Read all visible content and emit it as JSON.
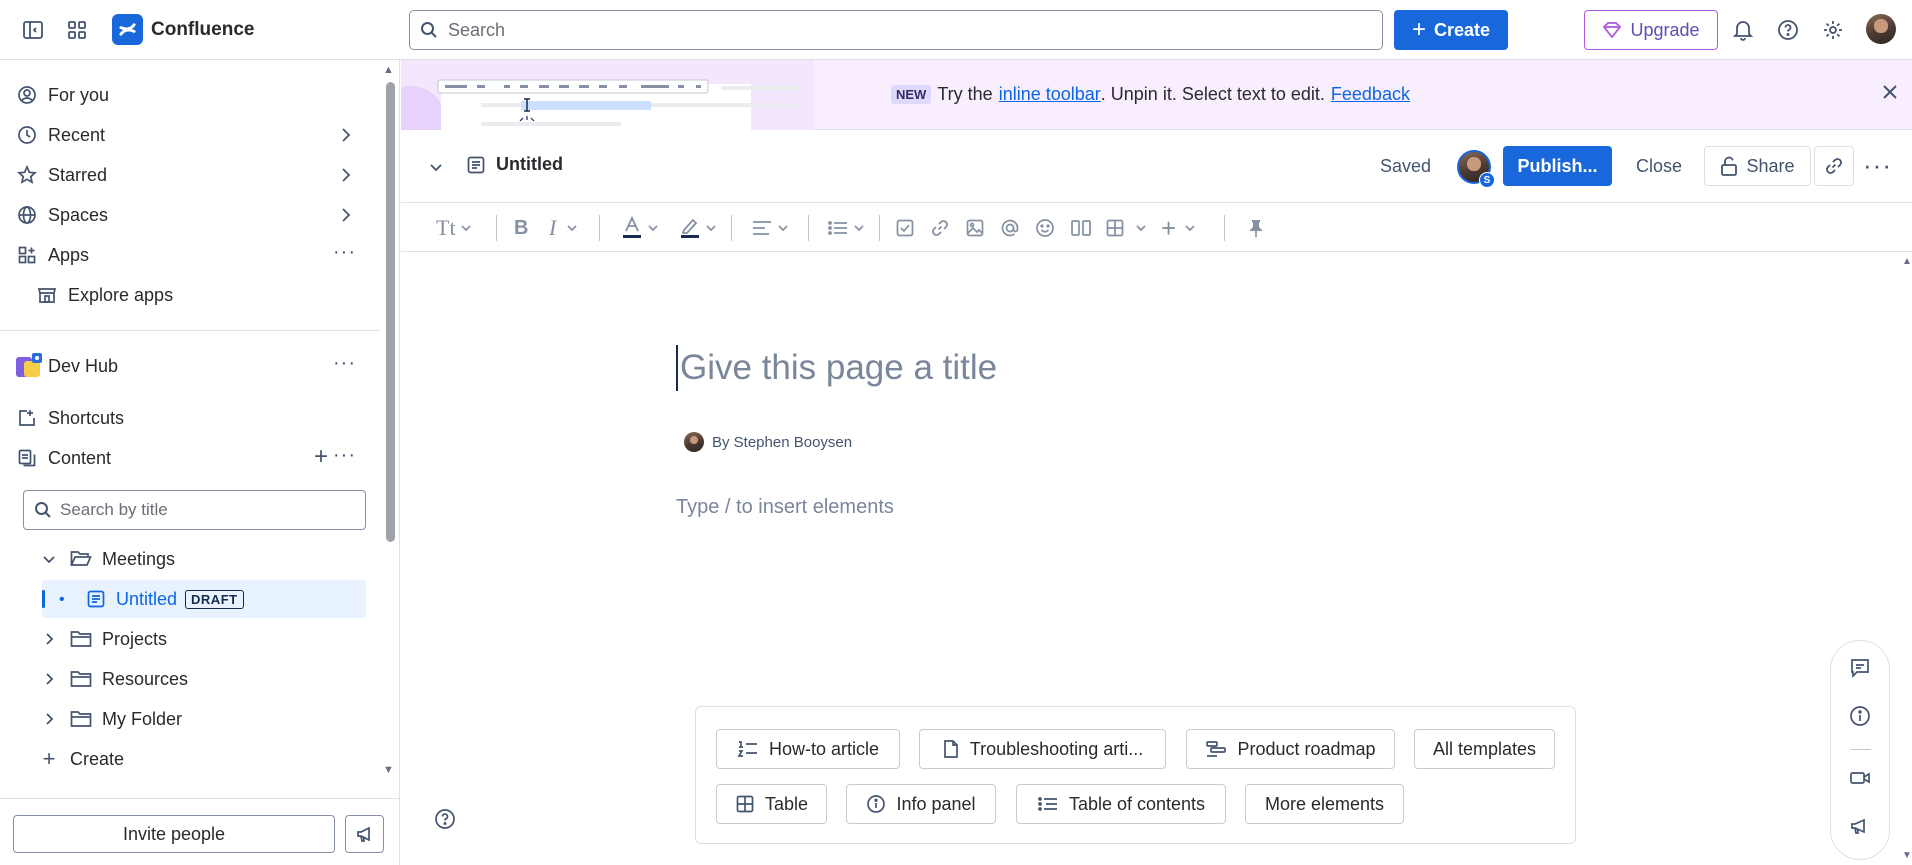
{
  "topnav": {
    "app_name": "Confluence",
    "search_placeholder": "Search",
    "create_label": "Create",
    "upgrade_label": "Upgrade"
  },
  "sidebar": {
    "nav": [
      {
        "label": "For you",
        "icon": "person-circle-icon"
      },
      {
        "label": "Recent",
        "icon": "clock-icon"
      },
      {
        "label": "Starred",
        "icon": "star-icon"
      },
      {
        "label": "Spaces",
        "icon": "globe-icon"
      },
      {
        "label": "Apps",
        "icon": "apps-icon"
      }
    ],
    "explore_apps": "Explore apps",
    "space_name": "Dev Hub",
    "shortcuts": "Shortcuts",
    "content": "Content",
    "search_placeholder": "Search by title",
    "tree": [
      {
        "label": "Meetings",
        "expanded": true
      },
      {
        "label": "Untitled",
        "badge": "DRAFT",
        "active": true
      },
      {
        "label": "Projects"
      },
      {
        "label": "Resources"
      },
      {
        "label": "My Folder"
      }
    ],
    "create_label": "Create",
    "invite_label": "Invite people"
  },
  "banner": {
    "badge": "NEW",
    "text_before": "Try the",
    "link_text": "inline toolbar",
    "text_after": ". Unpin it. Select text to edit.",
    "feedback": "Feedback"
  },
  "page_header": {
    "title": "Untitled",
    "status": "Saved",
    "publish_label": "Publish...",
    "close_label": "Close",
    "share_label": "Share",
    "collab_badge": "S"
  },
  "editor": {
    "title_placeholder": "Give this page a title",
    "byline": "By Stephen Booysen",
    "body_placeholder": "Type / to insert elements",
    "toolbar_text_style": "Tt"
  },
  "templates": [
    {
      "label": "How-to article",
      "icon": "numbered-list-icon"
    },
    {
      "label": "Troubleshooting arti...",
      "icon": "document-icon"
    },
    {
      "label": "Product roadmap",
      "icon": "roadmap-icon"
    },
    {
      "label": "All templates",
      "icon": ""
    },
    {
      "label": "Table",
      "icon": "table-icon"
    },
    {
      "label": "Info panel",
      "icon": "info-icon"
    },
    {
      "label": "Table of contents",
      "icon": "toc-icon"
    },
    {
      "label": "More elements",
      "icon": ""
    }
  ],
  "colors": {
    "primary": "#1868db",
    "banner_bg": "#f8eefe",
    "upgrade_border": "#af59e1",
    "active_item_bg": "#e9f2ff"
  }
}
